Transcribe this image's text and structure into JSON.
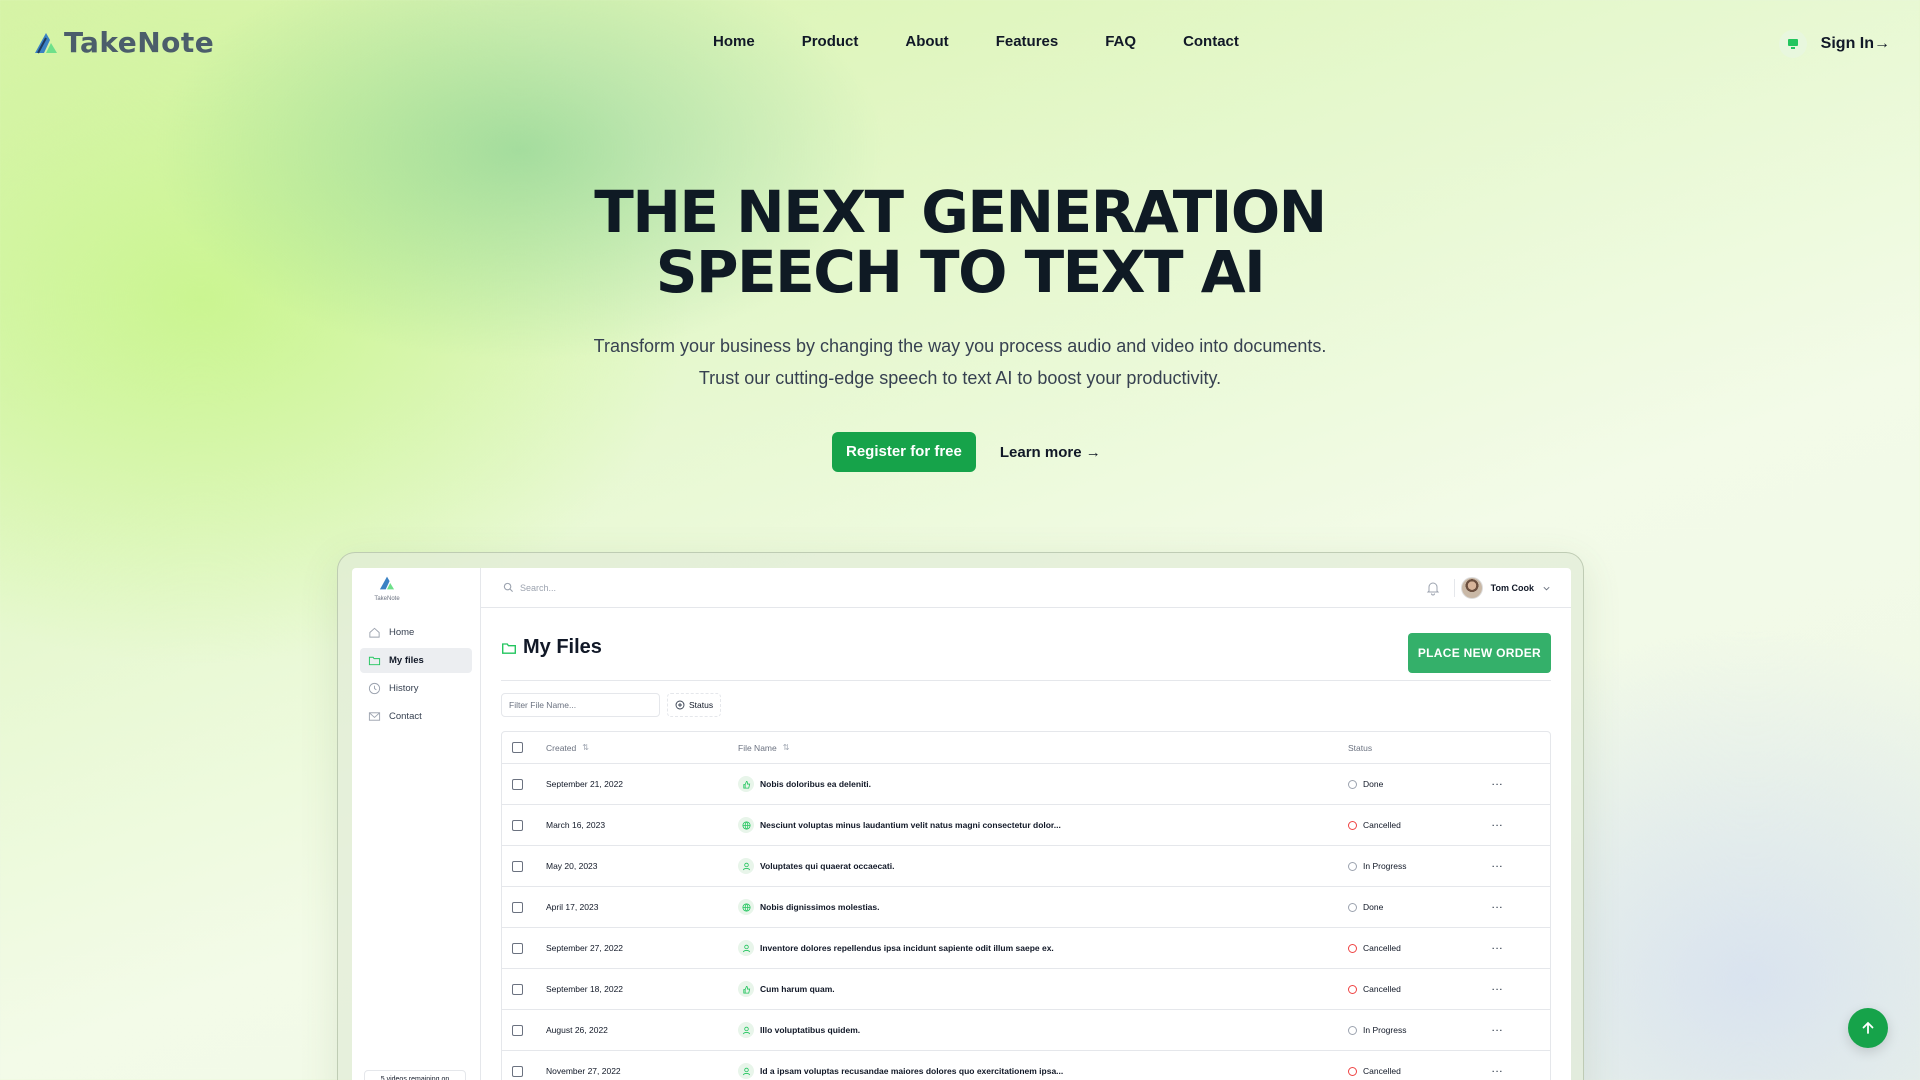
{
  "brand": {
    "name": "TakeNote"
  },
  "nav": {
    "links": [
      "Home",
      "Product",
      "About",
      "Features",
      "FAQ",
      "Contact"
    ],
    "signin": "Sign In→"
  },
  "hero": {
    "title_line1": "THE NEXT GENERATION",
    "title_line2": "SPEECH TO TEXT AI",
    "sub_line1": "Transform your business by changing the way you process audio and video into documents.",
    "sub_line2": "Trust our cutting-edge speech to text AI to boost your productivity.",
    "register": "Register for free",
    "learn_more": "Learn more →"
  },
  "app": {
    "logo_text": "TakeNote",
    "sidebar": [
      {
        "label": "Home",
        "icon": "home-icon"
      },
      {
        "label": "My files",
        "icon": "folder-icon",
        "active": true
      },
      {
        "label": "History",
        "icon": "clock-icon"
      },
      {
        "label": "Contact",
        "icon": "mail-icon"
      }
    ],
    "sidebar_bottom": "5 videos remaining on",
    "search_placeholder": "Search...",
    "user_name": "Tom Cook",
    "page_title": "My Files",
    "place_order": "PLACE NEW ORDER",
    "filter_placeholder": "Filter File Name...",
    "status_filter": "Status",
    "columns": {
      "created": "Created",
      "file_name": "File Name",
      "status": "Status"
    },
    "rows": [
      {
        "created": "September 21, 2022",
        "file": "Nobis doloribus ea deleniti.",
        "status": "Done",
        "icon": "thumb"
      },
      {
        "created": "March 16, 2023",
        "file": "Nesciunt voluptas minus laudantium velit natus magni consectetur dolor...",
        "status": "Cancelled",
        "icon": "globe"
      },
      {
        "created": "May 20, 2023",
        "file": "Voluptates qui quaerat occaecati.",
        "status": "In Progress",
        "icon": "user"
      },
      {
        "created": "April 17, 2023",
        "file": "Nobis dignissimos molestias.",
        "status": "Done",
        "icon": "globe"
      },
      {
        "created": "September 27, 2022",
        "file": "Inventore dolores repellendus ipsa incidunt sapiente odit illum saepe ex.",
        "status": "Cancelled",
        "icon": "user"
      },
      {
        "created": "September 18, 2022",
        "file": "Cum harum quam.",
        "status": "Cancelled",
        "icon": "thumb"
      },
      {
        "created": "August 26, 2022",
        "file": "Illo voluptatibus quidem.",
        "status": "In Progress",
        "icon": "user"
      },
      {
        "created": "November 27, 2022",
        "file": "Id a ipsam voluptas recusandae maiores dolores quo exercitationem ipsa...",
        "status": "Cancelled",
        "icon": "user"
      }
    ]
  },
  "colors": {
    "accent": "#16a34a",
    "order_button": "#34b06a"
  }
}
